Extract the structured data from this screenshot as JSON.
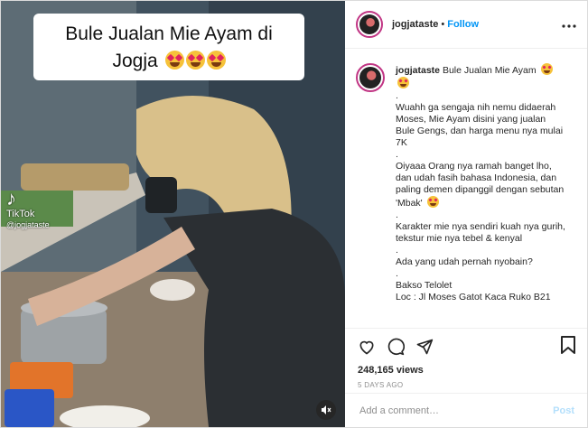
{
  "post": {
    "account": "jogjataste",
    "follow_label": "Follow",
    "separator": "•",
    "more_label": "•••"
  },
  "video": {
    "overlay_line1": "Bule Jualan Mie Ayam di",
    "overlay_line2": "Jogja",
    "tiktok_mark": "♪",
    "tiktok_label": "TikTok",
    "tiktok_handle": "@jogjataste"
  },
  "caption": {
    "author": "jogjataste",
    "title": "Bule Jualan Mie Ayam",
    "lines": [
      ".",
      "Wuahh ga sengaja nih nemu didaerah Moses, Mie Ayam disini yang jualan Bule Gengs, dan harga menu nya mulai 7K",
      ".",
      "Oiyaaa Orang nya ramah banget lho, dan udah fasih bahasa Indonesia, dan paling demen dipanggil dengan sebutan 'Mbak'",
      ".",
      "Karakter mie nya sendiri kuah nya gurih, tekstur mie nya tebel & kenyal",
      ".",
      "Ada yang udah pernah nyobain?",
      ".",
      "Bakso Telolet",
      "Loc : Jl Moses Gatot Kaca Ruko B21"
    ]
  },
  "stats": {
    "views": "248,165 views",
    "time_ago": "5 DAYS AGO"
  },
  "comment_box": {
    "placeholder": "Add a comment…",
    "post_label": "Post"
  },
  "icons": [
    "heart-icon",
    "comment-icon",
    "share-icon",
    "bookmark-icon",
    "mute-icon",
    "more-icon"
  ]
}
